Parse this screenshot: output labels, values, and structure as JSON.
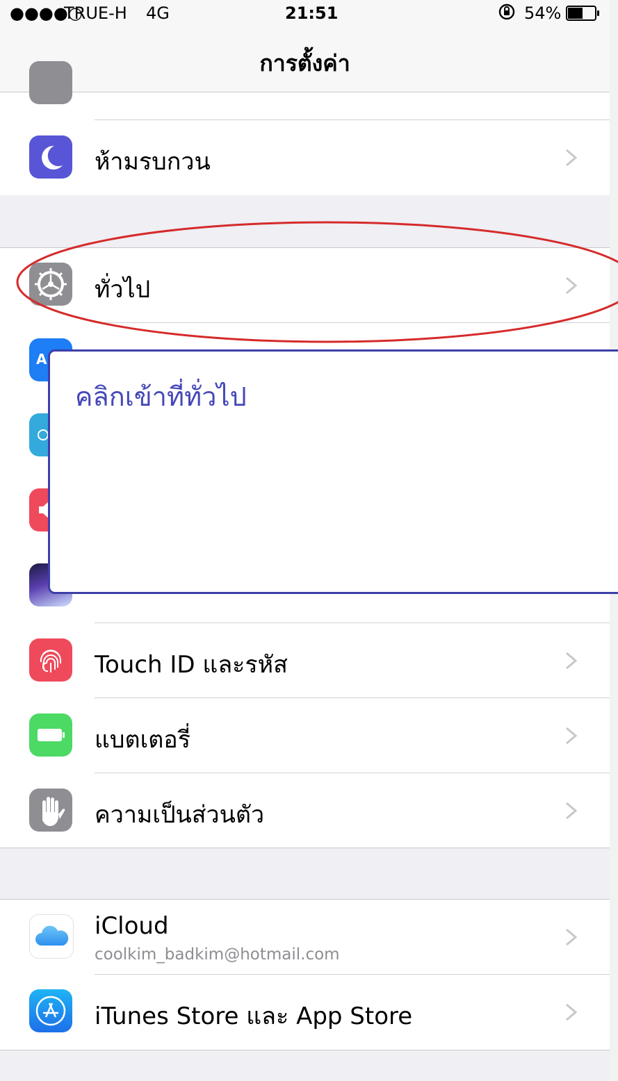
{
  "status": {
    "signal": "●●●●○",
    "carrier": "TRUE-H",
    "network": "4G",
    "time": "21:51",
    "battery": "54%",
    "battery_level": 0.54
  },
  "nav": {
    "title": "การตั้งค่า"
  },
  "rows": {
    "dnd": {
      "label": "ห้ามรบกวน",
      "icon": "moon-icon",
      "color": "#5856d6"
    },
    "general": {
      "label": "ทั่วไป",
      "icon": "gear-icon",
      "color": "#8e8e93"
    },
    "touchid": {
      "label": "Touch ID และรหัส",
      "icon": "fingerprint-icon",
      "color": "#ef4a5b"
    },
    "battery": {
      "label": "แบตเตอรี่",
      "icon": "battery-icon",
      "color": "#4cd964"
    },
    "privacy": {
      "label": "ความเป็นส่วนตัว",
      "icon": "hand-icon",
      "color": "#8e8e93"
    },
    "icloud": {
      "label": "iCloud",
      "sub": "coolkim_badkim@hotmail.com",
      "icon": "cloud-icon"
    },
    "itunes": {
      "label": "iTunes Store และ App Store",
      "icon": "app-store-icon",
      "color": "#1d8ef0"
    }
  },
  "hidden_icons": {
    "display": {
      "letter": "A",
      "color": "#1d7ef5"
    }
  },
  "annotation": {
    "text": "คลิกเข้าที่ทั่วไป",
    "circle_color": "#d62a2a",
    "box_color": "#3c3fa8"
  }
}
